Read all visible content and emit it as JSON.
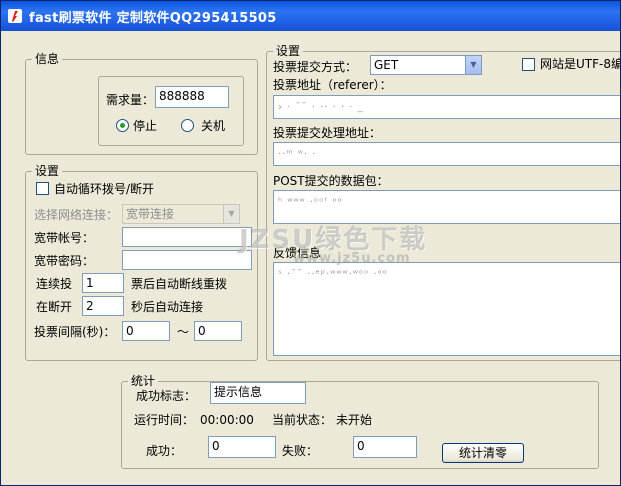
{
  "window": {
    "title": "fast刷票软件 定制软件QQ295415505",
    "icon": "app-logo-icon"
  },
  "info_group": {
    "legend": "信息",
    "demand_label": "需求量：",
    "demand_value": "888888",
    "stop_label": "停止",
    "shutdown_label": "关机",
    "selected_option": "停止"
  },
  "settings_left": {
    "legend": "设置",
    "auto_dial_label": "自动循环拨号/断开",
    "auto_dial_checked": false,
    "network_label": "选择网络连接：",
    "network_value": "宽带连接",
    "broadband_account_label": "宽带帐号：",
    "broadband_account_value": "",
    "broadband_password_label": "宽带密码：",
    "broadband_password_value": "",
    "consecutive_label": "连续投",
    "consecutive_value": "1",
    "consecutive_suffix": "票后自动断线重拨",
    "reconnect_label": "在断开",
    "reconnect_value": "2",
    "reconnect_suffix": "秒后自动连接",
    "interval_label": "投票间隔(秒)：",
    "interval_from": "0",
    "interval_to": "0",
    "interval_sep": "～"
  },
  "settings_right": {
    "legend": "设置",
    "method_label": "投票提交方式：",
    "method_value": "GET",
    "utf8_label": "网站是UTF-8编",
    "utf8_checked": false,
    "referer_label": "投票地址（referer）：",
    "submit_url_label": "投票提交处理地址：",
    "post_label": "POST提交的数据包：",
    "feedback_label": "反馈信息"
  },
  "stats": {
    "legend": "统计",
    "success_flag_label": "成功标志：",
    "success_flag_value": "提示信息",
    "runtime_label": "运行时间：",
    "runtime_value": "00:00:00",
    "status_label": "当前状态：",
    "status_value": "未开始",
    "success_label": "成功：",
    "success_value": "0",
    "fail_label": "失败：",
    "fail_value": "0",
    "reset_button": "统计清零"
  },
  "watermark": {
    "text": "JZSU绿色下载",
    "sub": "www.jz5u.com"
  }
}
